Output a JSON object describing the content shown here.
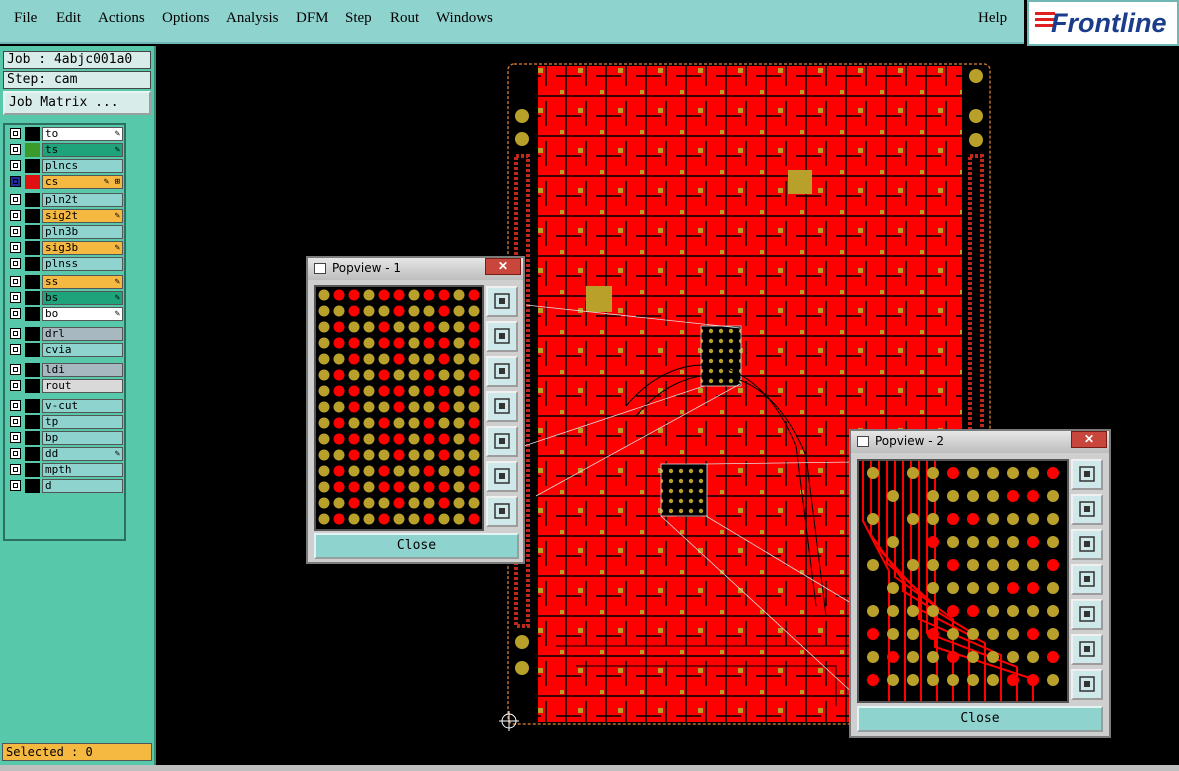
{
  "menu": {
    "items": [
      "File",
      "Edit",
      "Actions",
      "Options",
      "Analysis",
      "DFM",
      "Step",
      "Rout",
      "Windows"
    ],
    "help": "Help"
  },
  "brand": {
    "logo_text": "Frontline",
    "accent": "#e02020",
    "text_color": "#1a3c8a"
  },
  "job": {
    "job_label": "Job : 4abjc001a0",
    "step_label": "Step: cam",
    "matrix_button": "Job Matrix ..."
  },
  "layers": [
    {
      "name": "to",
      "bg": "#ffffff",
      "swatch": "#000000",
      "mark": "✎"
    },
    {
      "name": "ts",
      "bg": "#1fa37a",
      "swatch": "#3a9a2a",
      "mark": "✎"
    },
    {
      "name": "plncs",
      "bg": "#8fd3cf",
      "swatch": "#000000",
      "mark": ""
    },
    {
      "name": "cs",
      "bg": "#f5b942",
      "swatch": "#e01010",
      "mark": "✎ ⊞",
      "active": true
    },
    {
      "name": "pln2t",
      "bg": "#8fd3cf",
      "swatch": "#000000",
      "mark": ""
    },
    {
      "name": "sig2t",
      "bg": "#f5b942",
      "swatch": "#000000",
      "mark": "✎"
    },
    {
      "name": "pln3b",
      "bg": "#8fd3cf",
      "swatch": "#000000",
      "mark": ""
    },
    {
      "name": "sig3b",
      "bg": "#f5b942",
      "swatch": "#000000",
      "mark": "✎"
    },
    {
      "name": "plnss",
      "bg": "#8fd3cf",
      "swatch": "#000000",
      "mark": ""
    },
    {
      "name": "ss",
      "bg": "#f5b942",
      "swatch": "#000000",
      "mark": "✎"
    },
    {
      "name": "bs",
      "bg": "#1fa37a",
      "swatch": "#000000",
      "mark": "✎"
    },
    {
      "name": "bo",
      "bg": "#ffffff",
      "swatch": "#000000",
      "mark": "✎"
    },
    {
      "name": "drl",
      "bg": "#a7b8c0",
      "swatch": "#000000",
      "mark": ""
    },
    {
      "name": "cvia",
      "bg": "#8fd3cf",
      "swatch": "#000000",
      "mark": ""
    },
    {
      "name": "ldi",
      "bg": "#a7b8c0",
      "swatch": "#000000",
      "mark": ""
    },
    {
      "name": "rout",
      "bg": "#d9d9d9",
      "swatch": "#000000",
      "mark": ""
    },
    {
      "name": "v-cut",
      "bg": "#8fd3cf",
      "swatch": "#000000",
      "mark": ""
    },
    {
      "name": "tp",
      "bg": "#8fd3cf",
      "swatch": "#000000",
      "mark": ""
    },
    {
      "name": "bp",
      "bg": "#8fd3cf",
      "swatch": "#000000",
      "mark": ""
    },
    {
      "name": "dd",
      "bg": "#8fd3cf",
      "swatch": "#000000",
      "mark": "✎"
    },
    {
      "name": "mpth",
      "bg": "#8fd3cf",
      "swatch": "#000000",
      "mark": ""
    },
    {
      "name": "d",
      "bg": "#8fd3cf",
      "swatch": "#000000",
      "mark": ""
    }
  ],
  "status": {
    "selected": "Selected : 0"
  },
  "popview1": {
    "title": "Popview - 1",
    "close_label": "Close",
    "close_x": "✕"
  },
  "popview2": {
    "title": "Popview - 2",
    "close_label": "Close",
    "close_x": "✕"
  },
  "colors": {
    "copper": "#ff0000",
    "pad": "#b8a02a",
    "background": "#000000"
  },
  "popview_tools": [
    "zoom-fit-icon",
    "pan-up-icon",
    "pan-down-icon",
    "pan-left-icon",
    "pan-right-icon",
    "zoom-in-icon",
    "zoom-out-icon"
  ]
}
